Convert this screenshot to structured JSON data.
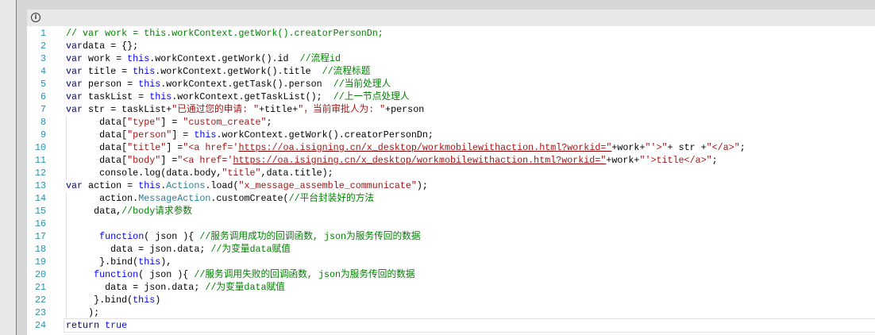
{
  "header": {
    "icon": "info-icon"
  },
  "colors": {
    "keyword": "#00008b",
    "this": "#0000ff",
    "comment": "#008000",
    "string": "#a31515",
    "type": "#267f99",
    "line_number": "#2b91af"
  },
  "active_line": 24,
  "lines": [
    {
      "n": "1",
      "t": [
        [
          "cm",
          "// var work = this.workContext.getWork().creatorPersonDn;"
        ]
      ]
    },
    {
      "n": "2",
      "t": [
        [
          "kw",
          "var"
        ],
        [
          "",
          "data = {};"
        ]
      ]
    },
    {
      "n": "3",
      "t": [
        [
          "kw",
          "var"
        ],
        [
          "",
          " work = "
        ],
        [
          "th",
          "this"
        ],
        [
          "",
          ".workContext.getWork().id  "
        ],
        [
          "cm",
          "//流程id"
        ]
      ]
    },
    {
      "n": "4",
      "t": [
        [
          "kw",
          "var"
        ],
        [
          "",
          " title = "
        ],
        [
          "th",
          "this"
        ],
        [
          "",
          ".workContext.getWork().title  "
        ],
        [
          "cm",
          "//流程标题"
        ]
      ]
    },
    {
      "n": "5",
      "t": [
        [
          "kw",
          "var"
        ],
        [
          "",
          " person = "
        ],
        [
          "th",
          "this"
        ],
        [
          "",
          ".workContext.getTask().person  "
        ],
        [
          "cm",
          "//当前处理人"
        ]
      ]
    },
    {
      "n": "6",
      "t": [
        [
          "kw",
          "var"
        ],
        [
          "",
          " taskList = "
        ],
        [
          "th",
          "this"
        ],
        [
          "",
          ".workContext.getTaskList();  "
        ],
        [
          "cm",
          "//上一节点处理人"
        ]
      ]
    },
    {
      "n": "7",
      "t": [
        [
          "kw",
          "var"
        ],
        [
          "",
          " str = taskList+"
        ],
        [
          "st",
          "\"已通过您的申请: \""
        ],
        [
          "",
          "+title+"
        ],
        [
          "st",
          "\"，当前审批人为: \""
        ],
        [
          "",
          "+person"
        ]
      ]
    },
    {
      "n": "8",
      "g": 1,
      "t": [
        [
          "",
          "      data["
        ],
        [
          "st",
          "\"type\""
        ],
        [
          "",
          "] = "
        ],
        [
          "st",
          "\"custom_create\""
        ],
        [
          "",
          ";"
        ]
      ]
    },
    {
      "n": "9",
      "g": 1,
      "t": [
        [
          "",
          "      data["
        ],
        [
          "st",
          "\"person\""
        ],
        [
          "",
          "] = "
        ],
        [
          "th",
          "this"
        ],
        [
          "",
          ".workContext.getWork().creatorPersonDn;"
        ]
      ]
    },
    {
      "n": "10",
      "g": 1,
      "t": [
        [
          "",
          "      data["
        ],
        [
          "st",
          "\"title\""
        ],
        [
          "",
          "] ="
        ],
        [
          "st",
          "\"<a href='"
        ],
        [
          "url",
          "https://oa.isigning.cn/x_desktop/workmobilewithaction.html?workid=\""
        ],
        [
          "",
          "+work+"
        ],
        [
          "st",
          "\"'>\""
        ],
        [
          "",
          "+ str +"
        ],
        [
          "st",
          "\"</a>\""
        ],
        [
          "",
          ";"
        ]
      ]
    },
    {
      "n": "11",
      "g": 1,
      "t": [
        [
          "",
          "      data["
        ],
        [
          "st",
          "\"body\""
        ],
        [
          "",
          "] ="
        ],
        [
          "st",
          "\"<a href='"
        ],
        [
          "url",
          "https://oa.isigning.cn/x_desktop/workmobilewithaction.html?workid=\""
        ],
        [
          "",
          "+work+"
        ],
        [
          "st",
          "\"'>title</a>\""
        ],
        [
          "",
          ";"
        ]
      ]
    },
    {
      "n": "12",
      "g": 1,
      "t": [
        [
          "",
          "      console.log(data.body,"
        ],
        [
          "st",
          "\"title\""
        ],
        [
          "",
          ",data.title);"
        ]
      ]
    },
    {
      "n": "13",
      "t": [
        [
          "kw",
          "var"
        ],
        [
          "",
          " action = "
        ],
        [
          "th",
          "this"
        ],
        [
          "",
          "."
        ],
        [
          "ty",
          "Actions"
        ],
        [
          "",
          ".load("
        ],
        [
          "st",
          "\"x_message_assemble_communicate\""
        ],
        [
          "",
          ");"
        ]
      ]
    },
    {
      "n": "14",
      "g": 1,
      "t": [
        [
          "",
          "      action."
        ],
        [
          "ty",
          "MessageAction"
        ],
        [
          "",
          ".customCreate("
        ],
        [
          "cm",
          "//平台封装好的方法"
        ]
      ]
    },
    {
      "n": "15",
      "g": 1,
      "t": [
        [
          "",
          "     data,"
        ],
        [
          "cm",
          "//body请求参数"
        ]
      ]
    },
    {
      "n": "16",
      "g": 1,
      "t": [
        [
          "",
          ""
        ]
      ]
    },
    {
      "n": "17",
      "g": 1,
      "t": [
        [
          "",
          "      "
        ],
        [
          "th",
          "function"
        ],
        [
          "",
          "( json ){ "
        ],
        [
          "cm",
          "//服务调用成功的回调函数, json为服务传回的数据"
        ]
      ]
    },
    {
      "n": "18",
      "g": 1,
      "t": [
        [
          "",
          "        data = json.data; "
        ],
        [
          "cm",
          "//为变量data赋值"
        ]
      ]
    },
    {
      "n": "19",
      "g": 1,
      "t": [
        [
          "",
          "      }.bind("
        ],
        [
          "th",
          "this"
        ],
        [
          "",
          "),"
        ]
      ]
    },
    {
      "n": "20",
      "g": 1,
      "t": [
        [
          "",
          "     "
        ],
        [
          "th",
          "function"
        ],
        [
          "",
          "( json ){ "
        ],
        [
          "cm",
          "//服务调用失败的回调函数, json为服务传回的数据"
        ]
      ]
    },
    {
      "n": "21",
      "g": 1,
      "t": [
        [
          "",
          "       data = json.data; "
        ],
        [
          "cm",
          "//为变量data赋值"
        ]
      ]
    },
    {
      "n": "22",
      "g": 1,
      "t": [
        [
          "",
          "     }.bind("
        ],
        [
          "th",
          "this"
        ],
        [
          "",
          ")"
        ]
      ]
    },
    {
      "n": "23",
      "g": 1,
      "t": [
        [
          "",
          "    );"
        ]
      ]
    },
    {
      "n": "24",
      "t": [
        [
          "kw",
          "return"
        ],
        [
          "",
          " "
        ],
        [
          "th",
          "true"
        ]
      ]
    }
  ]
}
